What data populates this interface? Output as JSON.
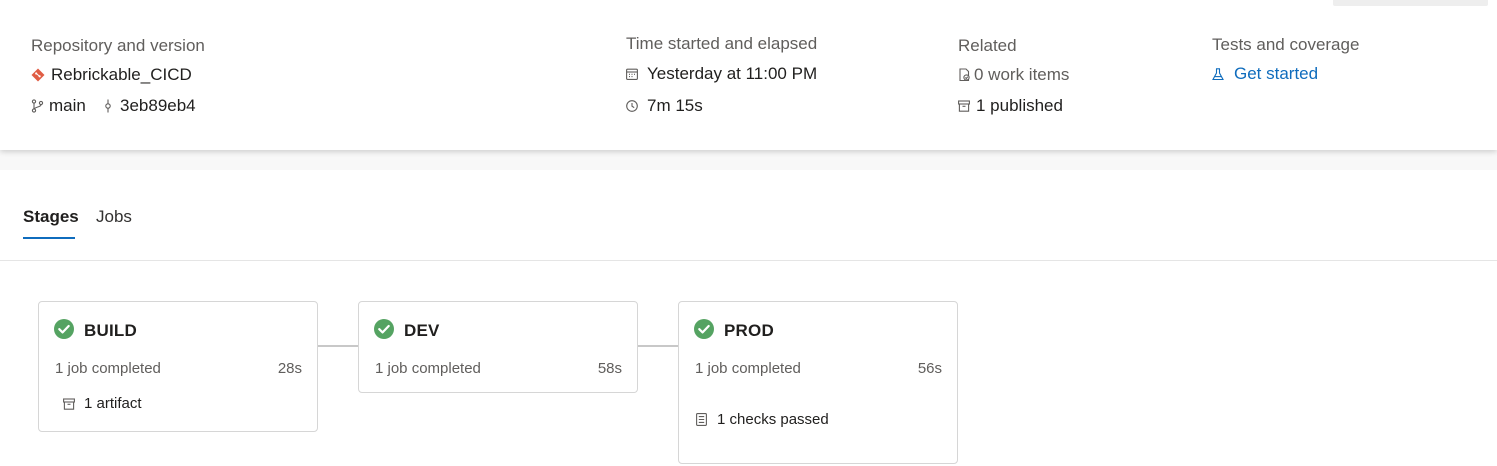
{
  "summary": {
    "repository": {
      "label": "Repository and version",
      "repo_name": "Rebrickable_CICD",
      "branch": "main",
      "commit": "3eb89eb4"
    },
    "time": {
      "label": "Time started and elapsed",
      "started": "Yesterday at 11:00 PM",
      "elapsed": "7m 15s"
    },
    "related": {
      "label": "Related",
      "work_items": "0 work items",
      "published": "1 published"
    },
    "tests": {
      "label": "Tests and coverage",
      "link": "Get started"
    }
  },
  "tabs": [
    {
      "label": "Stages",
      "active": true
    },
    {
      "label": "Jobs",
      "active": false
    }
  ],
  "stages": [
    {
      "name": "BUILD",
      "status": "succeeded",
      "jobs": "1 job completed",
      "duration": "28s",
      "extra": "1 artifact",
      "extra_icon": "artifact-icon"
    },
    {
      "name": "DEV",
      "status": "succeeded",
      "jobs": "1 job completed",
      "duration": "58s"
    },
    {
      "name": "PROD",
      "status": "succeeded",
      "jobs": "1 job completed",
      "duration": "56s",
      "extra": "1 checks passed",
      "extra_icon": "checklist-icon"
    }
  ],
  "colors": {
    "success": "#55a362",
    "link": "#0f6cbd",
    "git_brand": "#e05d44"
  }
}
